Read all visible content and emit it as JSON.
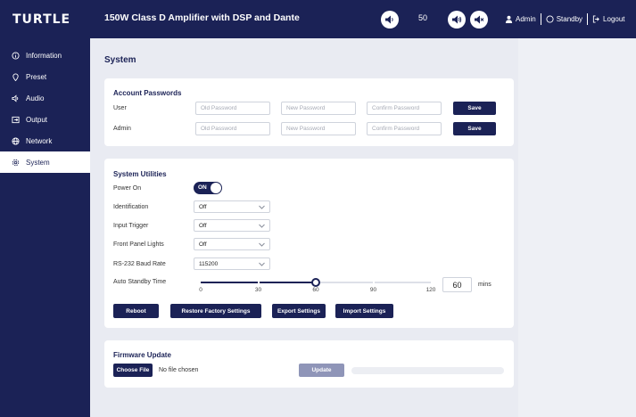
{
  "app": {
    "logo": "TURTLE",
    "product_title": "150W Class D Amplifier with DSP and Dante"
  },
  "header": {
    "volume_value": "50",
    "user_label": "Admin",
    "standby_label": "Standby",
    "logout_label": "Logout"
  },
  "sidebar": {
    "items": [
      {
        "label": "Information",
        "icon": "info-icon"
      },
      {
        "label": "Preset",
        "icon": "location-pin-icon"
      },
      {
        "label": "Audio",
        "icon": "speaker-icon"
      },
      {
        "label": "Output",
        "icon": "output-icon"
      },
      {
        "label": "Network",
        "icon": "globe-icon"
      },
      {
        "label": "System",
        "icon": "gear-icon"
      }
    ],
    "active_index": 5
  },
  "page": {
    "title": "System"
  },
  "passwords": {
    "title": "Account Passwords",
    "rows": [
      {
        "label": "User",
        "old_placeholder": "Old Password",
        "new_placeholder": "New Password",
        "confirm_placeholder": "Confirm Password",
        "save_label": "Save"
      },
      {
        "label": "Admin",
        "old_placeholder": "Old Password",
        "new_placeholder": "New Password",
        "confirm_placeholder": "Confirm Password",
        "save_label": "Save"
      }
    ]
  },
  "utilities": {
    "title": "System Utilities",
    "power_on": {
      "label": "Power On",
      "state": "ON"
    },
    "identification": {
      "label": "Identification",
      "value": "Off"
    },
    "input_trigger": {
      "label": "Input Trigger",
      "value": "Off"
    },
    "front_panel_lights": {
      "label": "Front Panel Lights",
      "value": "Off"
    },
    "baud_rate": {
      "label": "RS-232 Baud Rate",
      "value": "115200"
    },
    "auto_standby": {
      "label": "Auto Standby Time",
      "min": 0,
      "max": 120,
      "value": 60,
      "ticks": [
        "0",
        "30",
        "60",
        "90",
        "120"
      ],
      "input_value": "60",
      "unit": "mins"
    },
    "buttons": {
      "reboot": "Reboot",
      "restore": "Restore Factory Settings",
      "export": "Export Settings",
      "import": "Import Settings"
    }
  },
  "firmware": {
    "title": "Firmware Update",
    "choose_label": "Choose File",
    "file_status": "No file chosen",
    "update_label": "Update",
    "progress": 0
  },
  "colors": {
    "navy": "#1b2256",
    "background": "#eef0f5",
    "disabled_button": "#8f95b8"
  }
}
